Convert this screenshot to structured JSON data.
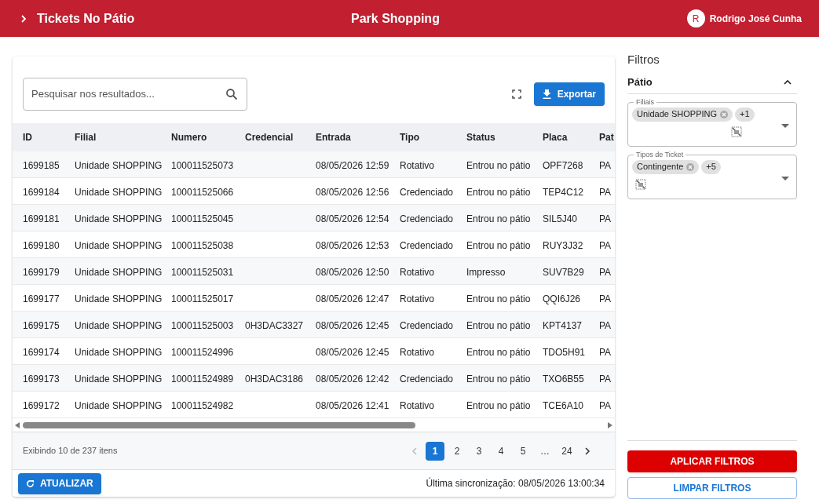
{
  "header": {
    "title": "Tickets No Pátio",
    "center_title": "Park Shopping",
    "user": {
      "initial": "R",
      "name": "Rodrigo José Cunha"
    }
  },
  "toolbar": {
    "search": {
      "placeholder": "Pesquisar nos resultados..."
    },
    "export_button": "Exportar"
  },
  "table": {
    "columns": [
      "ID",
      "Filial",
      "Numero",
      "Credencial",
      "Entrada",
      "Tipo",
      "Status",
      "Placa",
      "Pat"
    ],
    "rows": [
      [
        "1699185",
        "Unidade SHOPPING",
        "100011525073",
        "",
        "08/05/2026 12:59",
        "Rotativo",
        "Entrou no pátio",
        "OPF7268",
        "PA"
      ],
      [
        "1699184",
        "Unidade SHOPPING",
        "100011525066",
        "",
        "08/05/2026 12:56",
        "Credenciado",
        "Entrou no pátio",
        "TEP4C12",
        "PA"
      ],
      [
        "1699181",
        "Unidade SHOPPING",
        "100011525045",
        "",
        "08/05/2026 12:54",
        "Credenciado",
        "Entrou no pátio",
        "SIL5J40",
        "PA"
      ],
      [
        "1699180",
        "Unidade SHOPPING",
        "100011525038",
        "",
        "08/05/2026 12:53",
        "Credenciado",
        "Entrou no pátio",
        "RUY3J32",
        "PA"
      ],
      [
        "1699179",
        "Unidade SHOPPING",
        "100011525031",
        "",
        "08/05/2026 12:50",
        "Rotativo",
        "Impresso",
        "SUV7B29",
        "PA"
      ],
      [
        "1699177",
        "Unidade SHOPPING",
        "100011525017",
        "",
        "08/05/2026 12:47",
        "Rotativo",
        "Entrou no pátio",
        "QQI6J26",
        "PA"
      ],
      [
        "1699175",
        "Unidade SHOPPING",
        "100011525003",
        "0H3DAC3327",
        "08/05/2026 12:45",
        "Credenciado",
        "Entrou no pátio",
        "KPT4137",
        "PA"
      ],
      [
        "1699174",
        "Unidade SHOPPING",
        "100011524996",
        "",
        "08/05/2026 12:45",
        "Rotativo",
        "Entrou no pátio",
        "TDO5H91",
        "PA"
      ],
      [
        "1699173",
        "Unidade SHOPPING",
        "100011524989",
        "0H3DAC3186",
        "08/05/2026 12:42",
        "Credenciado",
        "Entrou no pátio",
        "TXO6B55",
        "PA"
      ],
      [
        "1699172",
        "Unidade SHOPPING",
        "100011524982",
        "",
        "08/05/2026 12:41",
        "Rotativo",
        "Entrou no pátio",
        "TCE6A10",
        "PA"
      ]
    ]
  },
  "pagination": {
    "summary": "Exibindo 10 de 237 itens",
    "pages": [
      {
        "label": "1",
        "selected": true
      },
      {
        "label": "2",
        "selected": false
      },
      {
        "label": "3",
        "selected": false
      },
      {
        "label": "4",
        "selected": false
      },
      {
        "label": "5",
        "selected": false
      },
      {
        "label": "…",
        "selected": false
      },
      {
        "label": "24",
        "selected": false
      }
    ]
  },
  "footer": {
    "refresh_button": "ATUALIZAR",
    "sync": "Última sincronização: 08/05/2026 13:00:34"
  },
  "filters": {
    "title": "Filtros",
    "section": {
      "title": "Pátio",
      "expanded": true,
      "fields": [
        {
          "label": "Filiais",
          "chips": [
            "Unidade SHOPPING"
          ],
          "more": "+1"
        },
        {
          "label": "Tipos de Ticket",
          "chips": [
            "Contingente"
          ],
          "more": "+5"
        }
      ]
    },
    "apply_button": "APLICAR FILTROS",
    "clear_button": "LIMPAR FILTROS"
  }
}
